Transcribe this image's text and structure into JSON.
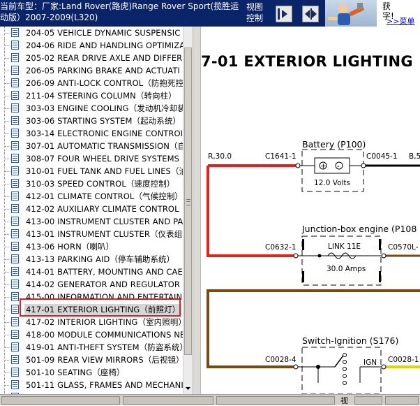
{
  "header": {
    "vehicle_line1": "当前车型：厂家:Land Rover(路虎)Range Rover Sport(揽胜运",
    "vehicle_line2": "动版）2007-2009(L320)",
    "view_line1": "视图",
    "view_line2": "控制",
    "nav_prev_icon": "collapse-left-icon",
    "nav_next_icon": "expand-right-icon",
    "ad_text_line1": "获",
    "ad_text_line2": "字!",
    "ad_link": ">>菜单"
  },
  "tree": {
    "items": [
      {
        "label": "204-05 VEHICLE DYNAMIC SUSPENSIC"
      },
      {
        "label": "204-06 RIDE AND HANDLING OPTIMIZA"
      },
      {
        "label": "205-02 REAR DRIVE AXLE AND DIFFER"
      },
      {
        "label": "206-05 PARKING BRAKE AND ACTUATI"
      },
      {
        "label": "206-09 ANTI-LOCK CONTROL（防抱死控"
      },
      {
        "label": "211-04 STEERING COLUMN（转向柱）"
      },
      {
        "label": "303-03 ENGINE COOLING（发动机冷却装"
      },
      {
        "label": "303-06 STARTING SYSTEM（起动系统）"
      },
      {
        "label": "303-14 ELECTRONIC ENGINE CONTROI"
      },
      {
        "label": "307-01 AUTOMATIC TRANSMISSION（自"
      },
      {
        "label": "308-07 FOUR WHEEL DRIVE SYSTEMS（"
      },
      {
        "label": "310-01 FUEL TANK AND FUEL LINES（油"
      },
      {
        "label": "310-03 SPEED CONTROL（速度控制）"
      },
      {
        "label": "412-01 CLIMATE CONTROL（气候控制）"
      },
      {
        "label": "412-02 AUXILIARY CLIMATE CONTROL"
      },
      {
        "label": "413-00 INSTRUMENT CLUSTER AND PA"
      },
      {
        "label": "413-01 INSTRUMENT CLUSTER（仪表组"
      },
      {
        "label": "413-06 HORN（喇叭）"
      },
      {
        "label": "413-13 PARKING AID（停车辅助系统）"
      },
      {
        "label": "414-01 BATTERY, MOUNTING AND CAE"
      },
      {
        "label": "414-02 GENERATOR AND REGULATOR（"
      },
      {
        "label": "415-00 INFORMATION AND ENTERTAIN"
      },
      {
        "label": "417-01 EXTERIOR LIGHTING（前照灯）"
      },
      {
        "label": "417-02 INTERIOR LIGHTING（室内照明）"
      },
      {
        "label": "418-00 MODULE COMMUNICATIONS NE"
      },
      {
        "label": "419-01 ANTI-THEFT SYSTEM（防盗系统）"
      },
      {
        "label": "501-09 REAR VIEW MIRRORS（后视镜）"
      },
      {
        "label": "501-10 SEATING（座椅）"
      },
      {
        "label": "501-11 GLASS, FRAMES AND MECHANI"
      },
      {
        "label": "501-12 INSTRUMENT PANEL AND CONS"
      }
    ],
    "selected_index": 22
  },
  "diagram": {
    "title": "7-01 EXTERIOR LIGHTING",
    "wire_colors": {
      "red": "#e8201c",
      "black": "#000000",
      "brown": "#7a4a10",
      "yellow": "#d8d800"
    },
    "labels": {
      "r30": "R,30.0",
      "b5": "B,5",
      "c1641": "C1641-1",
      "c0045": "C0045-1",
      "battery": "Battery (P100)",
      "volts": "12.0 Volts",
      "junction": "Junction-box engine (P108",
      "c0632": "C0632-1",
      "c0570": "C0570L-",
      "link": "LINK 11E",
      "amps": "30.0 Amps",
      "switch": "Switch-Ignition (S176)",
      "c0028_4": "C0028-4",
      "c0028_1": "C0028-1",
      "ign": "IGN"
    }
  },
  "statusbar": {
    "view_label": "视"
  }
}
